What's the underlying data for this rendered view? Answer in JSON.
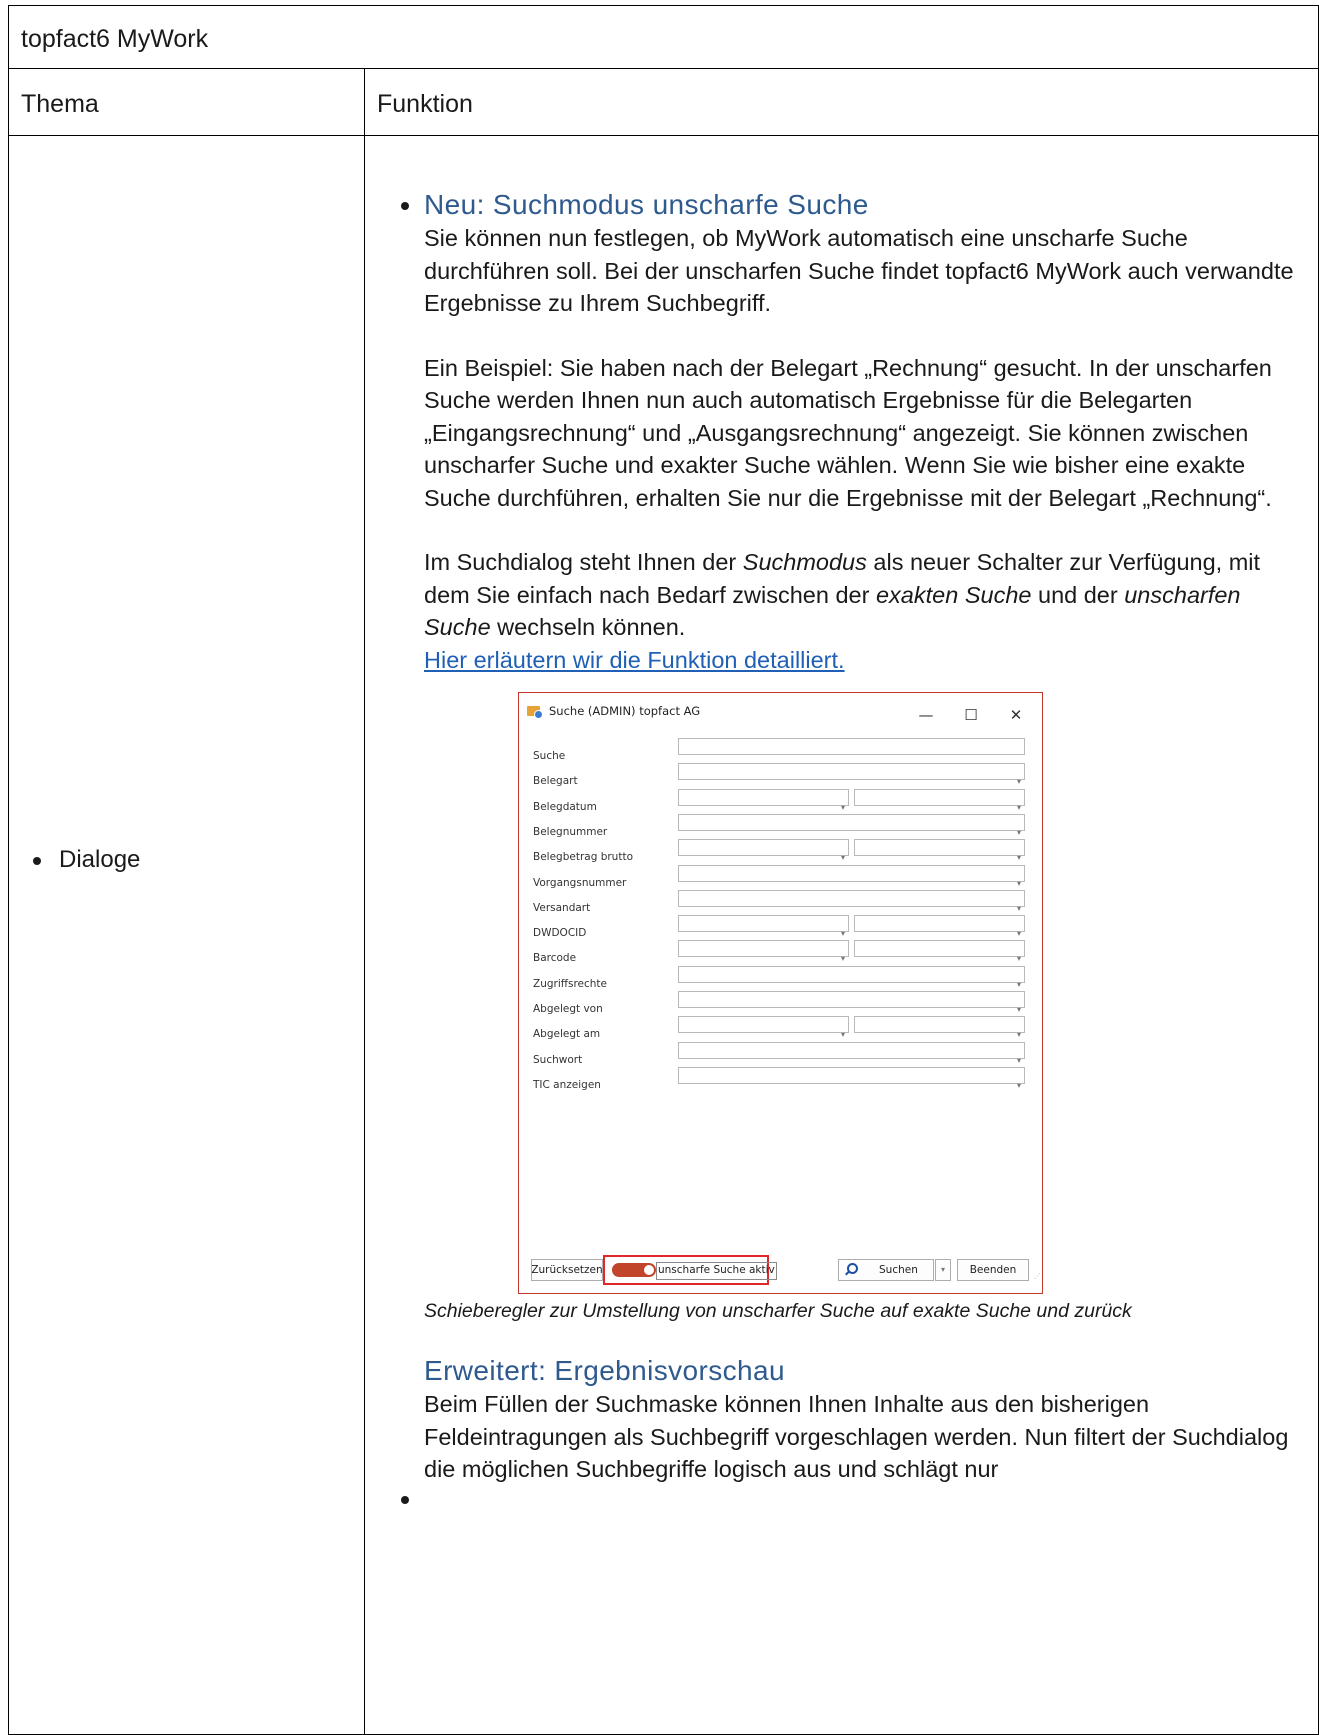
{
  "table": {
    "title": "topfact6 MyWork",
    "col1_header": "Thema",
    "col2_header": "Funktion",
    "topic": "Dialoge"
  },
  "section1": {
    "title": "Neu: Suchmodus unscharfe Suche",
    "p1": "Sie können nun festlegen, ob MyWork automatisch eine unscharfe Suche durchführen soll. Bei der unscharfen Suche findet topfact6 MyWork auch verwandte Ergebnisse zu Ihrem Suchbegriff.",
    "p2_label": "Ein Beispiel",
    "p2_text": ": Sie haben nach der Belegart „Rechnung“ gesucht. In der unscharfen Suche werden Ihnen nun auch automatisch Ergebnisse für die Belegarten „Eingangsrechnung“ und „Ausgangsrechnung“ angezeigt. Sie können zwischen unscharfer Suche und exakter Suche wählen. Wenn Sie wie bisher eine exakte Suche durchführen, erhalten Sie nur die Ergebnisse mit der Belegart „Rechnung“.",
    "p3_a": "Im Suchdialog steht Ihnen der ",
    "p3_em1": "Suchmodus",
    "p3_b": " als neuer Schalter zur Verfügung, mit dem Sie einfach nach Bedarf zwischen der ",
    "p3_em2": "exakten Suche",
    "p3_c": " und der ",
    "p3_em3": "unscharfen Suche",
    "p3_d": " wechseln können.",
    "link": "Hier erläutern wir die Funktion detailliert.",
    "caption": "Schieberegler zur Umstellung von unscharfer Suche auf exakte Suche und zurück"
  },
  "dialog": {
    "title": "Suche (ADMIN) topfact AG",
    "min": "—",
    "max": "☐",
    "close": "✕",
    "fields": [
      {
        "label": "Suche"
      },
      {
        "label": "Belegart"
      },
      {
        "label": "Belegdatum"
      },
      {
        "label": "Belegnummer"
      },
      {
        "label": "Belegbetrag brutto"
      },
      {
        "label": "Vorgangsnummer"
      },
      {
        "label": "Versandart"
      },
      {
        "label": "DWDOCID"
      },
      {
        "label": "Barcode"
      },
      {
        "label": "Zugriffsrechte"
      },
      {
        "label": "Abgelegt von"
      },
      {
        "label": "Abgelegt am"
      },
      {
        "label": "Suchwort"
      },
      {
        "label": "TIC anzeigen"
      }
    ],
    "reset_button": "Zurücksetzen",
    "toggle_label": "unscharfe Suche aktiv",
    "toggle_on": true,
    "search_button": "Suchen",
    "close_button": "Beenden"
  },
  "section2": {
    "title": "Erweitert: Ergebnisvorschau",
    "p1": "Beim Füllen der Suchmaske können Ihnen Inhalte aus den bisherigen Feldeintragungen als Suchbegriff vorgeschlagen werden. Nun filtert der Suchdialog die möglichen Suchbegriffe logisch aus und schlägt nur"
  },
  "colors": {
    "heading": "#2e5a8e",
    "link": "#1f5fb5",
    "toggle": "#c0452b",
    "highlight": "#e0282a"
  }
}
